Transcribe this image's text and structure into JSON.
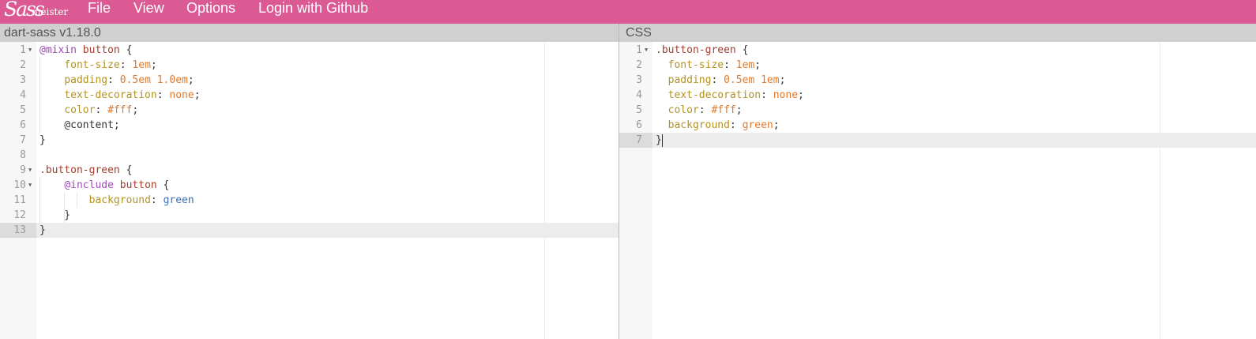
{
  "app": {
    "logo_script": "Sass",
    "logo_word": "meister"
  },
  "menu": {
    "file": "File",
    "view": "View",
    "options": "Options",
    "login": "Login with Github"
  },
  "left_panel": {
    "title": "dart-sass v1.18.0",
    "lines": [
      {
        "n": "1",
        "t": [
          [
            "kw",
            "@mixin"
          ],
          [
            "punct",
            " "
          ],
          [
            "sel",
            "button"
          ],
          [
            "punct",
            " {"
          ]
        ]
      },
      {
        "n": "2",
        "t": [
          [
            "punct",
            "    "
          ],
          [
            "prop",
            "font-size"
          ],
          [
            "punct",
            ": "
          ],
          [
            "num",
            "1em"
          ],
          [
            "punct",
            ";"
          ]
        ]
      },
      {
        "n": "3",
        "t": [
          [
            "punct",
            "    "
          ],
          [
            "prop",
            "padding"
          ],
          [
            "punct",
            ": "
          ],
          [
            "num",
            "0.5em 1.0em"
          ],
          [
            "punct",
            ";"
          ]
        ]
      },
      {
        "n": "4",
        "t": [
          [
            "punct",
            "    "
          ],
          [
            "prop",
            "text-decoration"
          ],
          [
            "punct",
            ": "
          ],
          [
            "num",
            "none"
          ],
          [
            "punct",
            ";"
          ]
        ]
      },
      {
        "n": "5",
        "t": [
          [
            "punct",
            "    "
          ],
          [
            "prop",
            "color"
          ],
          [
            "punct",
            ": "
          ],
          [
            "num",
            "#fff"
          ],
          [
            "punct",
            ";"
          ]
        ]
      },
      {
        "n": "6",
        "t": [
          [
            "punct",
            "    @content;"
          ]
        ]
      },
      {
        "n": "7",
        "t": [
          [
            "punct",
            "}"
          ]
        ]
      },
      {
        "n": "8",
        "t": []
      },
      {
        "n": "9",
        "t": [
          [
            "sel",
            ".button-green"
          ],
          [
            "punct",
            " {"
          ]
        ]
      },
      {
        "n": "10",
        "t": [
          [
            "punct",
            "    "
          ],
          [
            "kw",
            "@include"
          ],
          [
            "punct",
            " "
          ],
          [
            "sel",
            "button"
          ],
          [
            "punct",
            " {"
          ]
        ]
      },
      {
        "n": "11",
        "t": [
          [
            "punct",
            "        "
          ],
          [
            "prop",
            "background"
          ],
          [
            "punct",
            ": "
          ],
          [
            "str",
            "green"
          ]
        ]
      },
      {
        "n": "12",
        "t": [
          [
            "punct",
            "    }"
          ]
        ]
      },
      {
        "n": "13",
        "t": [
          [
            "punct",
            "}"
          ]
        ]
      }
    ]
  },
  "right_panel": {
    "title": "CSS",
    "lines": [
      {
        "n": "1",
        "t": [
          [
            "sel",
            ".button-green"
          ],
          [
            "punct",
            " {"
          ]
        ]
      },
      {
        "n": "2",
        "t": [
          [
            "punct",
            "  "
          ],
          [
            "prop",
            "font-size"
          ],
          [
            "punct",
            ": "
          ],
          [
            "num",
            "1em"
          ],
          [
            "punct",
            ";"
          ]
        ]
      },
      {
        "n": "3",
        "t": [
          [
            "punct",
            "  "
          ],
          [
            "prop",
            "padding"
          ],
          [
            "punct",
            ": "
          ],
          [
            "num",
            "0.5em 1em"
          ],
          [
            "punct",
            ";"
          ]
        ]
      },
      {
        "n": "4",
        "t": [
          [
            "punct",
            "  "
          ],
          [
            "prop",
            "text-decoration"
          ],
          [
            "punct",
            ": "
          ],
          [
            "num",
            "none"
          ],
          [
            "punct",
            ";"
          ]
        ]
      },
      {
        "n": "5",
        "t": [
          [
            "punct",
            "  "
          ],
          [
            "prop",
            "color"
          ],
          [
            "punct",
            ": "
          ],
          [
            "num",
            "#fff"
          ],
          [
            "punct",
            ";"
          ]
        ]
      },
      {
        "n": "6",
        "t": [
          [
            "punct",
            "  "
          ],
          [
            "prop",
            "background"
          ],
          [
            "punct",
            ": "
          ],
          [
            "num",
            "green"
          ],
          [
            "punct",
            ";"
          ]
        ]
      },
      {
        "n": "7",
        "t": [
          [
            "punct",
            "}"
          ]
        ]
      }
    ]
  },
  "colors": {
    "brand": "#dc5a94",
    "header_bg": "#d0d0d0",
    "keyword": "#9c4cb5",
    "selector": "#a33f2e",
    "property": "#b39321",
    "value": "#e0792c",
    "string": "#3b6fb3"
  }
}
